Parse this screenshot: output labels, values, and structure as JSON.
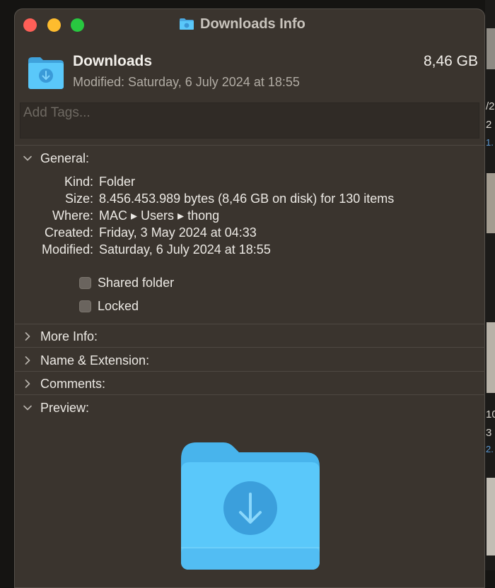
{
  "window": {
    "title": "Downloads Info"
  },
  "header": {
    "name": "Downloads",
    "size": "8,46 GB",
    "modified": "Modified: Saturday, 6 July 2024 at 18:55"
  },
  "tags": {
    "placeholder": "Add Tags..."
  },
  "general": {
    "title": "General:",
    "rows": [
      {
        "label": "Kind:",
        "value": "Folder"
      },
      {
        "label": "Size:",
        "value": "8.456.453.989 bytes (8,46 GB on disk) for 130 items"
      },
      {
        "label": "Where:",
        "value": "MAC ▸ Users ▸ thong"
      },
      {
        "label": "Created:",
        "value": "Friday, 3 May 2024 at 04:33"
      },
      {
        "label": "Modified:",
        "value": "Saturday, 6 July 2024 at 18:55"
      }
    ],
    "checkboxes": [
      {
        "label": "Shared folder",
        "checked": false
      },
      {
        "label": "Locked",
        "checked": false
      }
    ]
  },
  "sections": {
    "more_info": "More Info:",
    "name_extension": "Name & Extension:",
    "comments": "Comments:",
    "preview": "Preview:"
  },
  "background_fragments": [
    "/2",
    "2",
    "1.",
    "10",
    "3",
    "2."
  ],
  "colors": {
    "folder_blue": "#5ac8fa",
    "window_bg": "#3a342e",
    "close": "#fe5f57",
    "minimize": "#febc2e",
    "zoom": "#28c840"
  }
}
